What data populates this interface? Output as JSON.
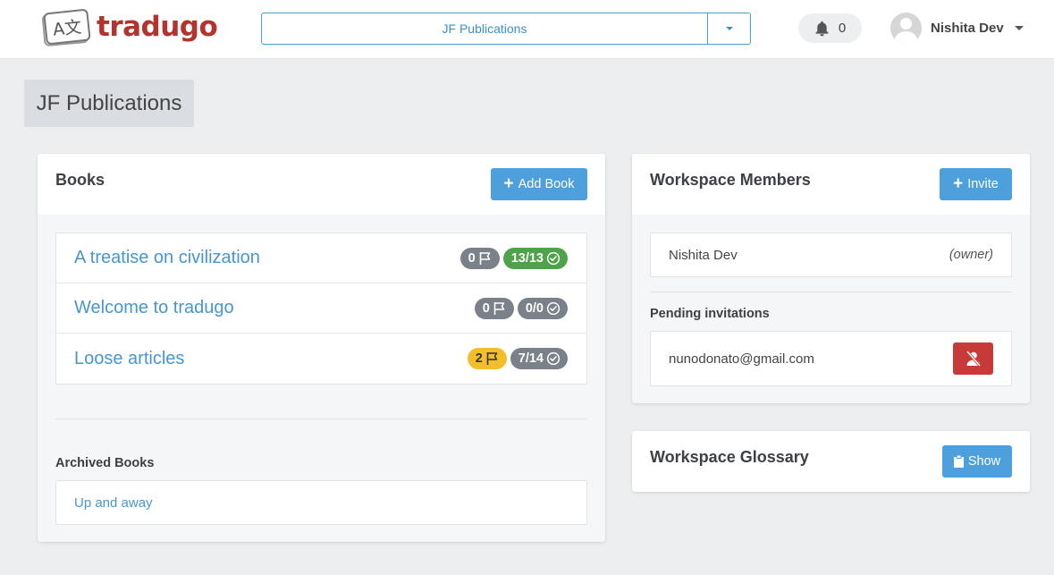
{
  "navbar": {
    "logo_glyph": "A文",
    "logo_text": "tradugo",
    "workspace_selected": "JF Publications",
    "notification_count": "0",
    "user_name": "Nishita Dev"
  },
  "page": {
    "title": "JF Publications"
  },
  "books_panel": {
    "title": "Books",
    "add_label": "Add Book",
    "books": [
      {
        "title": "A treatise on civilization",
        "flags": "0",
        "progress": "13/13",
        "flag_color": "gray",
        "progress_color": "green"
      },
      {
        "title": "Welcome to tradugo",
        "flags": "0",
        "progress": "0/0",
        "flag_color": "gray",
        "progress_color": "gray"
      },
      {
        "title": "Loose articles",
        "flags": "2",
        "progress": "7/14",
        "flag_color": "yellow",
        "progress_color": "gray"
      }
    ],
    "archived_label": "Archived Books",
    "archived": [
      {
        "title": "Up and away"
      }
    ]
  },
  "members_panel": {
    "title": "Workspace Members",
    "invite_label": "Invite",
    "members": [
      {
        "name": "Nishita Dev",
        "role": "(owner)"
      }
    ],
    "pending_label": "Pending invitations",
    "pending": [
      {
        "email": "nunodonato@gmail.com"
      }
    ]
  },
  "glossary_panel": {
    "title": "Workspace Glossary",
    "show_label": "Show"
  },
  "colors": {
    "brand": "#b4332e",
    "primary": "#4ea0dc",
    "link": "#4796cf",
    "success": "#4ea24a",
    "warning": "#f3bd2c",
    "danger": "#c73a37",
    "badge_gray": "#7a8189"
  }
}
